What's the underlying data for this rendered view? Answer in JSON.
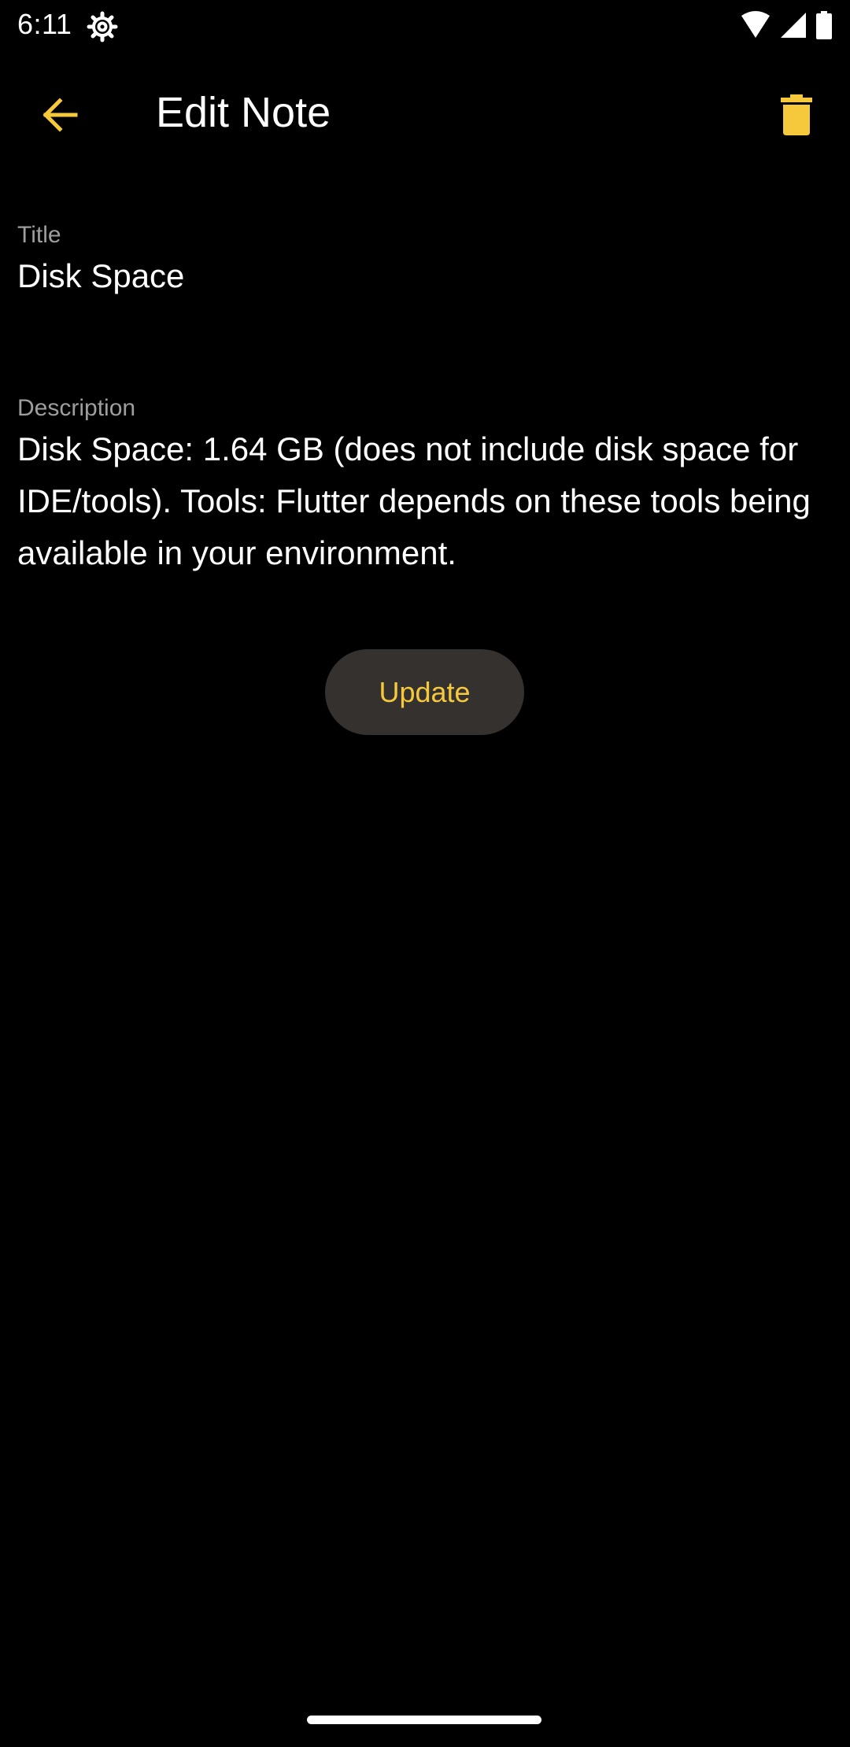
{
  "status_bar": {
    "time": "6:11",
    "icons": [
      "settings-gear-icon",
      "wifi-icon",
      "cell-signal-icon",
      "battery-icon"
    ]
  },
  "app_bar": {
    "title": "Edit Note",
    "back_icon": "arrow-back-icon",
    "delete_icon": "trash-icon"
  },
  "form": {
    "title_label": "Title",
    "title_value": "Disk Space",
    "description_label": "Description",
    "description_value": "Disk Space: 1.64 GB (does not include disk space for IDE/tools). Tools: Flutter depends on these tools being available in your environment."
  },
  "actions": {
    "update_label": "Update"
  },
  "colors": {
    "background": "#000000",
    "accent": "#f6c83c",
    "button_background": "#35312f",
    "label_gray": "#9e9e9e"
  }
}
